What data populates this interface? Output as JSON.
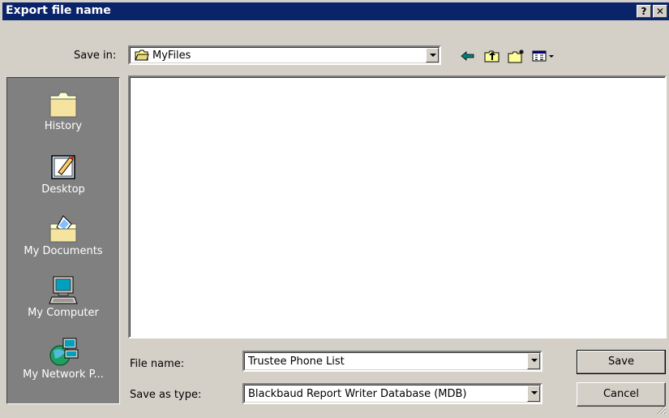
{
  "window": {
    "title": "Export file name",
    "help_button": "?",
    "close_button": "✕"
  },
  "save_in": {
    "label": "Save in:",
    "value": "MyFiles"
  },
  "toolbar": {
    "icons": [
      "back-arrow-icon",
      "up-folder-icon",
      "new-folder-icon",
      "view-menu-icon"
    ]
  },
  "places": [
    {
      "label": "History",
      "icon": "history-folder-icon"
    },
    {
      "label": "Desktop",
      "icon": "desktop-icon"
    },
    {
      "label": "My Documents",
      "icon": "my-documents-icon"
    },
    {
      "label": "My Computer",
      "icon": "my-computer-icon"
    },
    {
      "label": "My Network P...",
      "icon": "my-network-places-icon"
    }
  ],
  "file_name": {
    "label": "File name:",
    "value": "Trustee Phone List"
  },
  "save_as_type": {
    "label": "Save as type:",
    "value": "Blackbaud Report Writer Database (MDB)"
  },
  "buttons": {
    "save": "Save",
    "cancel": "Cancel"
  },
  "colors": {
    "titlebar": "#0a246a",
    "face": "#d4d0c8",
    "places_bg": "#808080",
    "arrow_teal": "#008080"
  }
}
